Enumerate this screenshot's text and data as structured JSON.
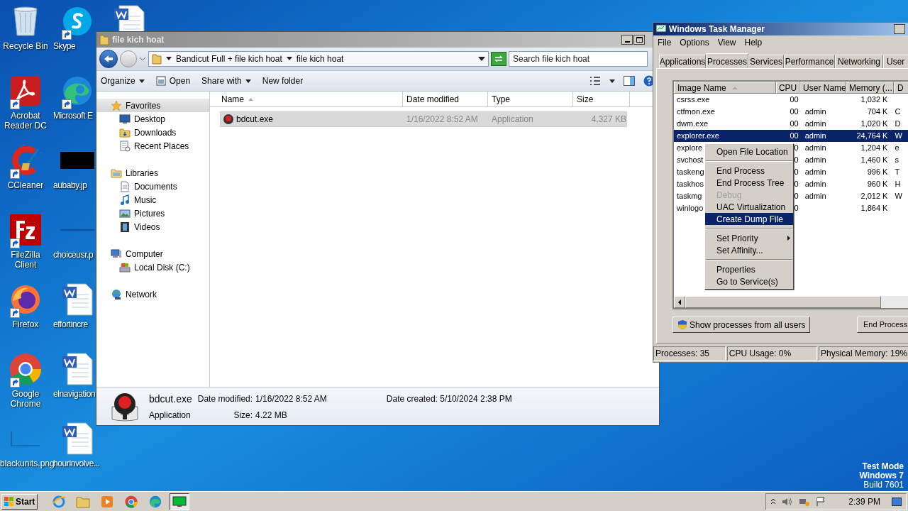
{
  "desktop": {
    "columns": [
      [
        {
          "kind": "recycle",
          "label": "Recycle Bin",
          "shortcut": false
        },
        {
          "kind": "pdf",
          "label": "Acrobat Reader DC",
          "shortcut": true
        },
        {
          "kind": "ccleaner",
          "label": "CCleaner",
          "shortcut": true
        },
        {
          "kind": "filezilla",
          "label": "FileZilla Client",
          "shortcut": true
        },
        {
          "kind": "firefox",
          "label": "Firefox",
          "shortcut": true
        },
        {
          "kind": "chrome",
          "label": "Google Chrome",
          "shortcut": true
        },
        {
          "kind": "blank",
          "label": "blackunits.png",
          "shortcut": false
        }
      ],
      [
        {
          "kind": "skype",
          "label": "Skype",
          "shortcut": true
        },
        {
          "kind": "edge",
          "label": "Microsoft E",
          "shortcut": true
        },
        {
          "kind": "black",
          "label": "aubaby.jp",
          "shortcut": false
        },
        {
          "kind": "line",
          "label": "choiceusr.p",
          "shortcut": false
        },
        {
          "kind": "document",
          "label": "effortincre",
          "shortcut": false
        },
        {
          "kind": "document",
          "label": "elnavigation",
          "shortcut": false
        },
        {
          "kind": "document",
          "label": "hourinvolve...",
          "shortcut": false
        }
      ],
      [
        {
          "kind": "document",
          "shortcut": false
        }
      ]
    ],
    "watermark_text": [
      "Test Mode",
      "Windows 7",
      "Build 7601"
    ]
  },
  "explorer": {
    "title": "file kich hoat",
    "breadcrumb": [
      "Bandicut Full + file kich hoat",
      "file kich hoat"
    ],
    "search": {
      "placeholder": "Search file kich hoat"
    },
    "toolbar": [
      {
        "label": "Organize",
        "kind": "menu"
      },
      {
        "label": "Open",
        "kind": "open"
      },
      {
        "label": "Share with",
        "kind": "menu"
      },
      {
        "label": "New folder",
        "kind": "plain"
      }
    ],
    "nav": [
      {
        "label": "Favorites",
        "selected": true,
        "children": [
          {
            "label": "Desktop",
            "selected": false
          },
          {
            "label": "Downloads",
            "selected": false
          },
          {
            "label": "Recent Places",
            "selected": false
          }
        ]
      },
      {
        "label": "Libraries",
        "selected": false,
        "children": [
          {
            "label": "Documents",
            "selected": false
          },
          {
            "label": "Music",
            "selected": false
          },
          {
            "label": "Pictures",
            "selected": false
          },
          {
            "label": "Videos",
            "selected": false
          }
        ]
      },
      {
        "label": "Computer",
        "selected": false,
        "children": [
          {
            "label": "Local Disk (C:)",
            "selected": false
          }
        ]
      },
      {
        "label": "Network",
        "selected": false
      }
    ],
    "columns": [
      {
        "label": "Name",
        "sorted": true
      },
      {
        "label": "Date modified",
        "sorted": false
      },
      {
        "label": "Type",
        "sorted": false
      },
      {
        "label": "Size",
        "sorted": false
      }
    ],
    "files": [
      {
        "name": "bdcut.exe",
        "date": "1/16/2022 8:52 AM",
        "type": "Application",
        "size": "4,327 KB",
        "selected": true
      }
    ],
    "details": {
      "name": "bdcut.exe",
      "type": "Application",
      "fields": [
        {
          "label": "Date modified:",
          "value": "1/16/2022 8:52 AM"
        },
        {
          "label": "Size:",
          "value": "4.22 MB"
        },
        {
          "label": "Date created:",
          "value": "5/10/2024 2:38 PM"
        }
      ]
    }
  },
  "task_manager": {
    "title": "Windows Task Manager",
    "menu": [
      "File",
      "Options",
      "View",
      "Help"
    ],
    "tabs": [
      {
        "label": "Applications",
        "selected": false
      },
      {
        "label": "Processes",
        "selected": true
      },
      {
        "label": "Services",
        "selected": false
      },
      {
        "label": "Performance",
        "selected": false
      },
      {
        "label": "Networking",
        "selected": false
      },
      {
        "label": "User",
        "selected": false
      }
    ],
    "columns": [
      "Image Name",
      "CPU",
      "User Name",
      "Memory (...",
      "D"
    ],
    "rows": [
      {
        "image": "csrss.exe",
        "cpu": "00",
        "memory": "1,032 K",
        "selected": false
      },
      {
        "image": "ctfmon.exe",
        "cpu": "00",
        "user": "admin",
        "memory": "704 K",
        "column_5": "C",
        "selected": false
      },
      {
        "image": "dwm.exe",
        "cpu": "00",
        "user": "admin",
        "memory": "1,020 K",
        "column_5": "D",
        "selected": false
      },
      {
        "image": "explorer.exe",
        "cpu": "00",
        "user": "admin",
        "memory": "24,764 K",
        "column_5": "W",
        "selected": true
      },
      {
        "image": "explore",
        "cpu": "0",
        "user": "admin",
        "memory": "1,204 K",
        "column_5": "e",
        "selected": false
      },
      {
        "image": "svchost",
        "cpu": "0",
        "user": "admin",
        "memory": "1,460 K",
        "column_5": "s",
        "selected": false
      },
      {
        "image": "taskeng",
        "cpu": "0",
        "user": "admin",
        "memory": "996 K",
        "column_5": "T",
        "selected": false
      },
      {
        "image": "taskhos",
        "cpu": "0",
        "user": "admin",
        "memory": "960 K",
        "column_5": "H",
        "selected": false
      },
      {
        "image": "taskmg",
        "cpu": "0",
        "user": "admin",
        "memory": "2,012 K",
        "column_5": "W",
        "selected": false
      },
      {
        "image": "winlogo",
        "cpu": "0",
        "memory": "1,864 K",
        "selected": false
      }
    ],
    "context_menu": [
      {
        "kind": "item",
        "label": "Open File Location",
        "disabled": false,
        "selected": false,
        "submenu": false
      },
      {
        "kind": "separator"
      },
      {
        "kind": "item",
        "label": "End Process",
        "disabled": false,
        "selected": false,
        "submenu": false
      },
      {
        "kind": "item",
        "label": "End Process Tree",
        "disabled": false,
        "selected": false,
        "submenu": false
      },
      {
        "kind": "item",
        "label": "Debug",
        "disabled": true,
        "selected": false,
        "submenu": false
      },
      {
        "kind": "item",
        "label": "UAC Virtualization",
        "disabled": false,
        "selected": false,
        "submenu": false
      },
      {
        "kind": "item",
        "label": "Create Dump File",
        "disabled": false,
        "selected": true,
        "submenu": false
      },
      {
        "kind": "separator"
      },
      {
        "kind": "item",
        "label": "Set Priority",
        "disabled": false,
        "selected": false,
        "submenu": true
      },
      {
        "kind": "item",
        "label": "Set Affinity...",
        "disabled": false,
        "selected": false,
        "submenu": false
      },
      {
        "kind": "separator"
      },
      {
        "kind": "item",
        "label": "Properties",
        "disabled": false,
        "selected": false,
        "submenu": false
      },
      {
        "kind": "item",
        "label": "Go to Service(s)",
        "disabled": false,
        "selected": false,
        "submenu": false
      }
    ],
    "buttons": [
      "Show processes from all users",
      "End Process"
    ],
    "status_bar": [
      "Processes: 35",
      "CPU Usage: 0%",
      "Physical Memory: 19%"
    ]
  },
  "taskbar": {
    "start": "Start",
    "items": [
      {
        "kind": "ie",
        "active": false
      },
      {
        "kind": "folder",
        "active": false
      },
      {
        "kind": "media",
        "active": false
      },
      {
        "kind": "chrome",
        "active": false
      },
      {
        "kind": "edge",
        "active": false
      },
      {
        "kind": "taskmgr",
        "active": true
      }
    ],
    "clock": "2:39 PM"
  }
}
